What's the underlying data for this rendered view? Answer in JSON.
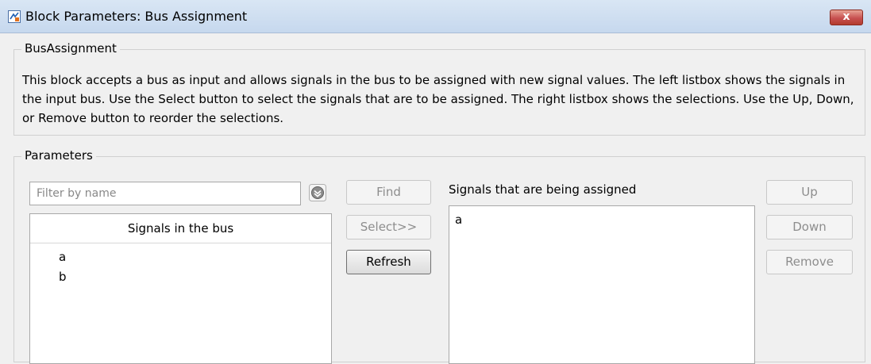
{
  "window": {
    "title": "Block Parameters: Bus Assignment",
    "close_label": "x"
  },
  "description_group": {
    "title": "BusAssignment",
    "text": "This block accepts a bus as input and allows signals in the bus to be assigned with new signal values. The left listbox shows the signals in the input bus. Use the Select button to select the signals that are to be assigned. The right listbox shows the selections. Use the Up, Down, or Remove button to reorder the selections."
  },
  "parameters": {
    "title": "Parameters",
    "filter": {
      "placeholder": "Filter by name",
      "value": ""
    },
    "left_list": {
      "header": "Signals in the bus",
      "items": [
        "a",
        "b"
      ]
    },
    "buttons": {
      "find": "Find",
      "select": "Select>>",
      "refresh": "Refresh",
      "up": "Up",
      "down": "Down",
      "remove": "Remove"
    },
    "right_list": {
      "label": "Signals that are being assigned",
      "items": [
        "a"
      ]
    }
  },
  "colors": {
    "titlebar": "#c6d8ee",
    "close_button": "#c75050",
    "disabled_text": "#8d8d8d"
  },
  "icons": [
    "matlab-block-icon",
    "close-icon",
    "filter-options-icon"
  ]
}
